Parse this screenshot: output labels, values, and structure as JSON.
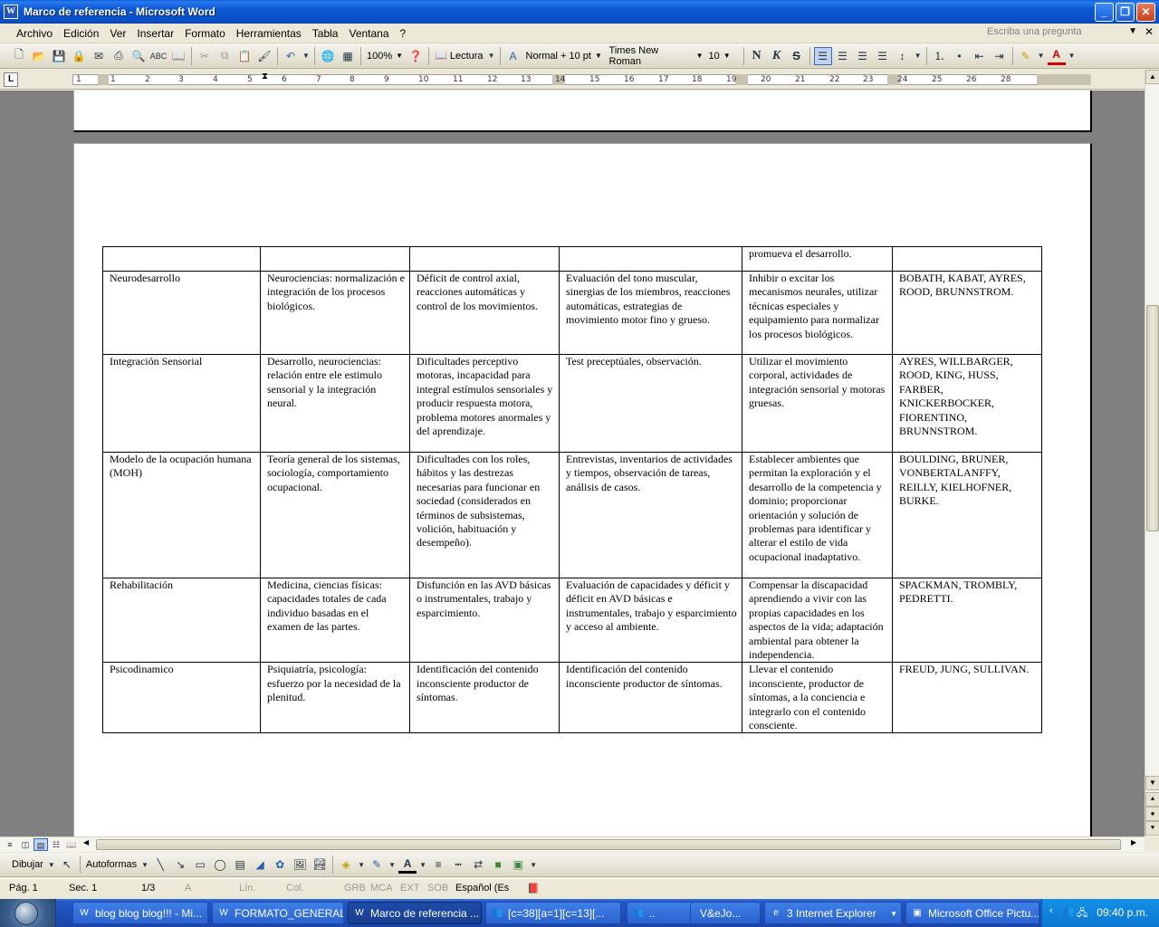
{
  "window": {
    "title": "Marco de referencia - Microsoft Word",
    "app_icon": "W"
  },
  "menu": {
    "items": [
      "Archivo",
      "Edición",
      "Ver",
      "Insertar",
      "Formato",
      "Herramientas",
      "Tabla",
      "Ventana",
      "?"
    ],
    "help_placeholder": "Escriba una pregunta"
  },
  "toolbar": {
    "zoom": "100%",
    "reading": "Lectura",
    "style": "Normal + 10 pt",
    "font": "Times New Roman",
    "size": "10",
    "bold": "N",
    "italic": "K",
    "strike": "S"
  },
  "ruler": {
    "numbers": [
      "1",
      "1",
      "2",
      "3",
      "4",
      "5",
      "6",
      "7",
      "8",
      "9",
      "10",
      "11",
      "12",
      "13",
      "14",
      "15",
      "16",
      "17",
      "18",
      "19",
      "20",
      "21",
      "22",
      "23",
      "24",
      "25",
      "26",
      "28"
    ]
  },
  "table": {
    "rows": [
      [
        "",
        "",
        "",
        "",
        "promueva el desarrollo.",
        ""
      ],
      [
        "Neurodesarrollo",
        "Neurociencias: normalización e integración de los procesos biológicos.",
        "Déficit de control axial, reacciones automáticas y control de los movimientos.",
        "Evaluación del tono muscular, sinergias de los miembros, reacciones automáticas, estrategias de movimiento motor fino y grueso.",
        "Inhibir o excitar los mecanismos neurales, utilizar técnicas especiales y equipamiento para normalizar los procesos biológicos.",
        "BOBATH, KABAT, AYRES, ROOD, BRUNNSTROM."
      ],
      [
        "Integración Sensorial",
        "Desarrollo, neurociencias: relación entre ele estimulo sensorial y la integración neural.",
        "Dificultades perceptivo motoras, incapacidad para integral estímulos sensoriales y producir respuesta motora, problema motores anormales y del aprendizaje.",
        "Test preceptúales, observación.",
        "Utilizar el movimiento corporal, actividades de integración sensorial y motoras gruesas.",
        "AYRES, WILLBARGER, ROOD, KING, HUSS, FARBER, KNICKERBOCKER, FIORENTINO, BRUNNSTROM."
      ],
      [
        "Modelo de la ocupación humana (MOH)",
        "Teoría general de los sistemas, sociología, comportamiento ocupacional.",
        "Dificultades con los roles, hábitos y las destrezas necesarias para funcionar en sociedad (considerados en términos de subsistemas, volición, habituación y desempeño).",
        "Entrevistas, inventarios de actividades y tiempos, observación de tareas, análisis de casos.",
        "Establecer ambientes que permitan la exploración y el desarrollo de la competencia y dominio; proporcionar orientación y solución de problemas para identificar y alterar el estilo de vida ocupacional inadaptativo.",
        "BOULDING, BRUNER, VONBERTALANFFY, REILLY, KIELHOFNER, BURKE."
      ],
      [
        "Rehabilitación",
        "Medicina, ciencias físicas: capacidades totales de cada individuo basadas en el examen de las partes.",
        "Disfunción en las AVD básicas o instrumentales, trabajo y esparcimiento.",
        "Evaluación de capacidades y déficit y déficit en AVD básicas e instrumentales, trabajo y esparcimiento y acceso al ambiente.",
        "Compensar la discapacidad aprendiendo a vivir con las propias capacidades en los aspectos de la vida; adaptación ambiental para obtener la independencia.",
        "SPACKMAN, TROMBLY, PEDRETTI."
      ],
      [
        "Psicodinamico",
        "Psiquiatría, psicología: esfuerzo por la necesidad de la plenitud.",
        "Identificación del contenido inconsciente productor de síntomas.",
        "Identificación del contenido inconsciente productor de síntomas.",
        "Llevar el contenido inconsciente, productor de síntomas, a la conciencia e integrarlo con el contenido consciente.",
        "FREUD, JUNG, SULLIVAN."
      ]
    ]
  },
  "drawbar": {
    "draw": "Dibujar",
    "autoshapes": "Autoformas"
  },
  "status": {
    "page": "Pág. 1",
    "section": "Sec. 1",
    "pages": "1/3",
    "at": "A",
    "line": "Lín.",
    "col": "Col.",
    "rec": "GRB",
    "trk": "MCA",
    "ext": "EXT",
    "ovr": "SOB",
    "lang": "Español (Es"
  },
  "taskbar": {
    "tasks": [
      "blog blog blog!!! - Mi...",
      "FORMATO_GENERAL...",
      "Marco de referencia ...",
      "[c=38][a=1][c=13][...",
      "..",
      "V&eJo...",
      "3 Internet Explorer",
      "Microsoft Office Pictu..."
    ],
    "clock": "09:40 p.m."
  }
}
